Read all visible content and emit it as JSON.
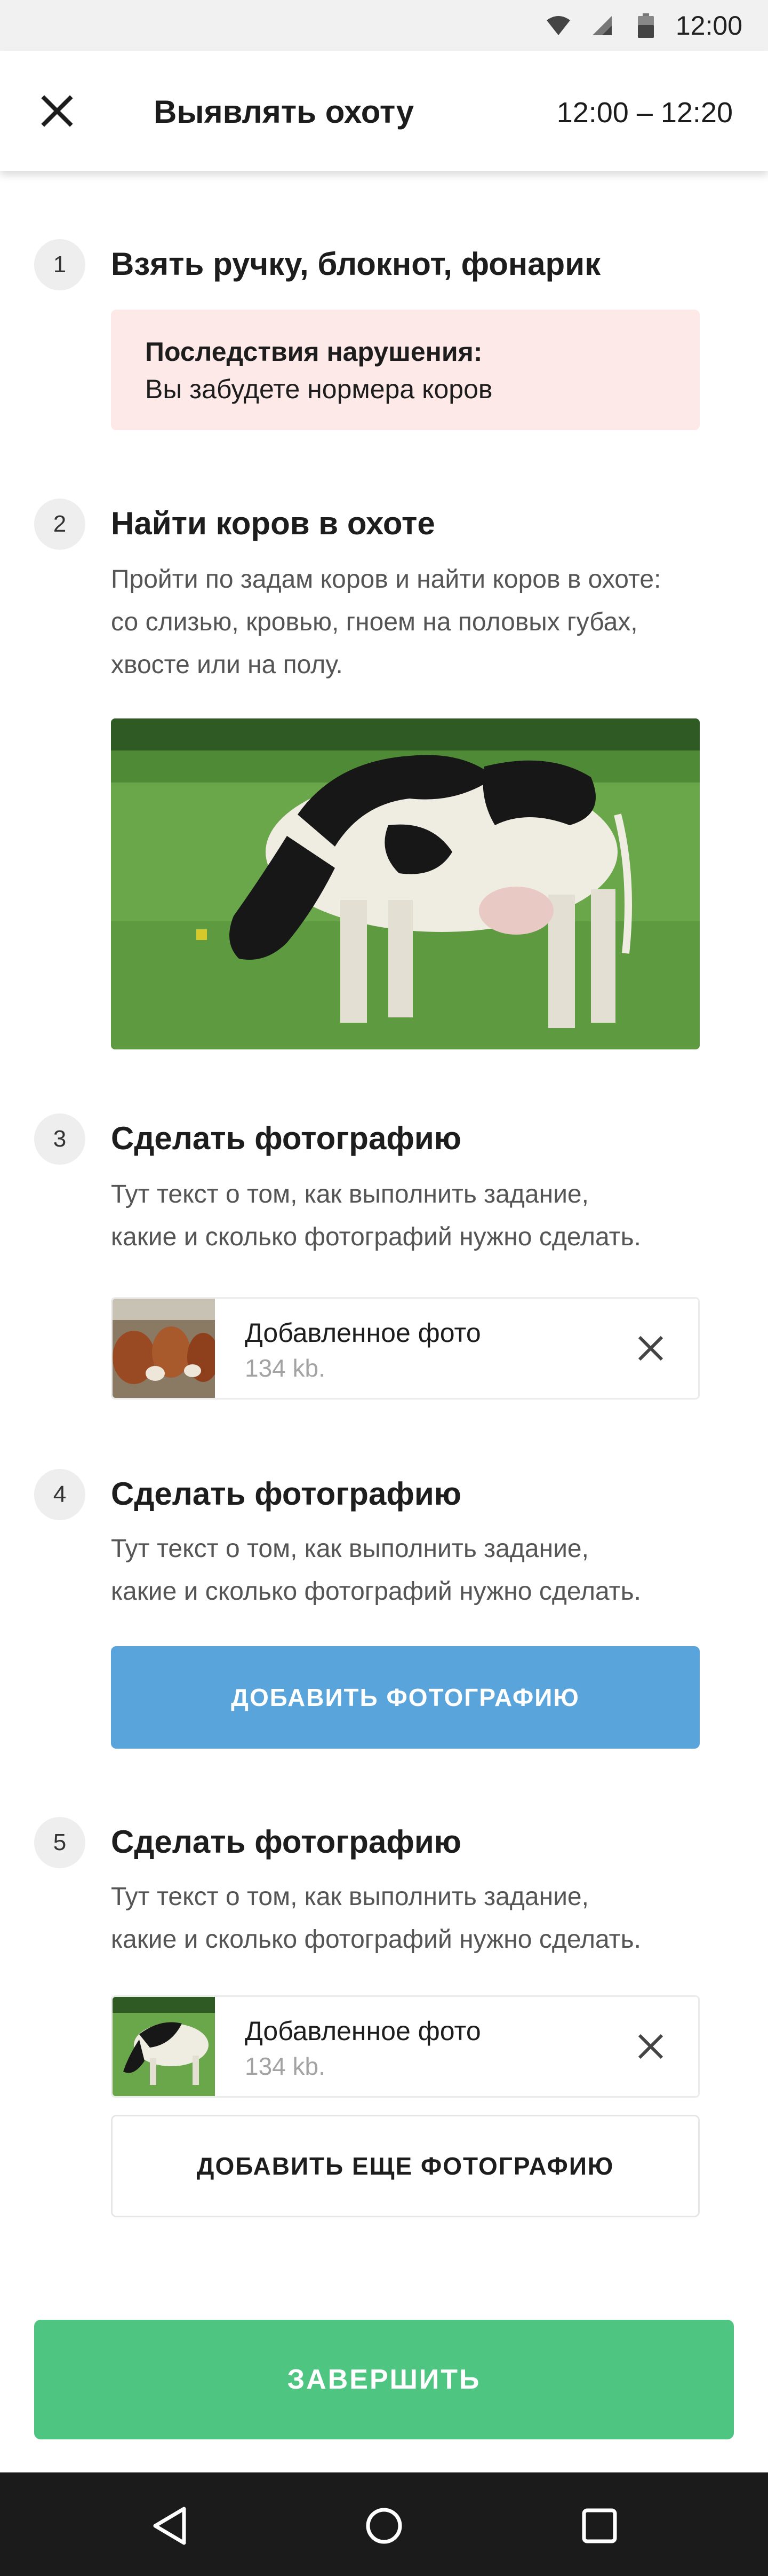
{
  "status_bar": {
    "time": "12:00",
    "icons": [
      "wifi-icon",
      "signal-icon",
      "battery-icon"
    ]
  },
  "header": {
    "title": "Выявлять охоту",
    "time_range": "12:00 – 12:20",
    "close_icon": "close-icon"
  },
  "steps": [
    {
      "number": "1",
      "title": "Взять ручку, блокнот, фонарик",
      "warning": {
        "title": "Последствия нарушения:",
        "text": "Вы забудете нормера коров"
      }
    },
    {
      "number": "2",
      "title": "Найти коров в охоте",
      "text_lines": [
        "Пройти по задам коров и найти коров в охоте:",
        "со слизью, кровью, гноем на половых губах,",
        "хвосте или на полу."
      ],
      "image": "cow-grazing-photo"
    },
    {
      "number": "3",
      "title": "Сделать фотографию",
      "text_lines": [
        "Тут текст о том, как выполнить задание,",
        "какие и сколько фотографий нужно сделать."
      ],
      "attachment": {
        "title": "Добавленное фото",
        "size": "134 kb."
      }
    },
    {
      "number": "4",
      "title": "Сделать фотографию",
      "text_lines": [
        "Тут текст о том, как выполнить задание,",
        "какие и сколько фотографий нужно сделать."
      ],
      "button_label": "ДОБАВИТЬ ФОТОГРАФИЮ"
    },
    {
      "number": "5",
      "title": "Сделать фотографию",
      "text_lines": [
        "Тут текст о том, как выполнить задание,",
        "какие и сколько фотографий нужно сделать."
      ],
      "attachment": {
        "title": "Добавленное фото",
        "size": "134 kb."
      },
      "button_label": "ДОБАВИТЬ ЕЩЕ ФОТОГРАФИЮ"
    }
  ],
  "footer": {
    "finish_label": "ЗАВЕРШИТЬ"
  },
  "nav_bar": {
    "icons": [
      "back-icon",
      "home-icon",
      "recents-icon"
    ]
  },
  "colors": {
    "accent_blue": "#5aa4dc",
    "accent_green": "#4fc582",
    "warning_bg": "#fde9e7",
    "nav_bg": "#1b1b1b"
  }
}
